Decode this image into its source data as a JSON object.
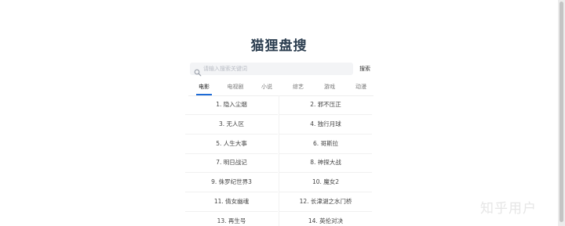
{
  "site": {
    "title": "猫狸盘搜"
  },
  "search": {
    "placeholder": "请输入搜索关键词",
    "value": "",
    "button_label": "搜索"
  },
  "tabs": [
    {
      "label": "电影",
      "active": true
    },
    {
      "label": "电视剧",
      "active": false
    },
    {
      "label": "小说",
      "active": false
    },
    {
      "label": "综艺",
      "active": false
    },
    {
      "label": "游戏",
      "active": false
    },
    {
      "label": "动漫",
      "active": false
    }
  ],
  "list": [
    "1. 隐入尘烟",
    "2. 邪不压正",
    "3. 无人区",
    "4. 独行月球",
    "5. 人生大事",
    "6. 哥斯拉",
    "7. 明日战记",
    "8. 神探大战",
    "9. 侏罗纪世界3",
    "10. 魔女2",
    "11. 倩女幽魂",
    "12. 长津湖之水门桥",
    "13. 再生号",
    "14. 英伦对决"
  ],
  "watermark": "知乎用户",
  "colors": {
    "title": "#2c3e50",
    "accent": "#1e6bd6",
    "search_bg": "#f3f4f6"
  },
  "icons": {
    "search": "search-icon"
  }
}
